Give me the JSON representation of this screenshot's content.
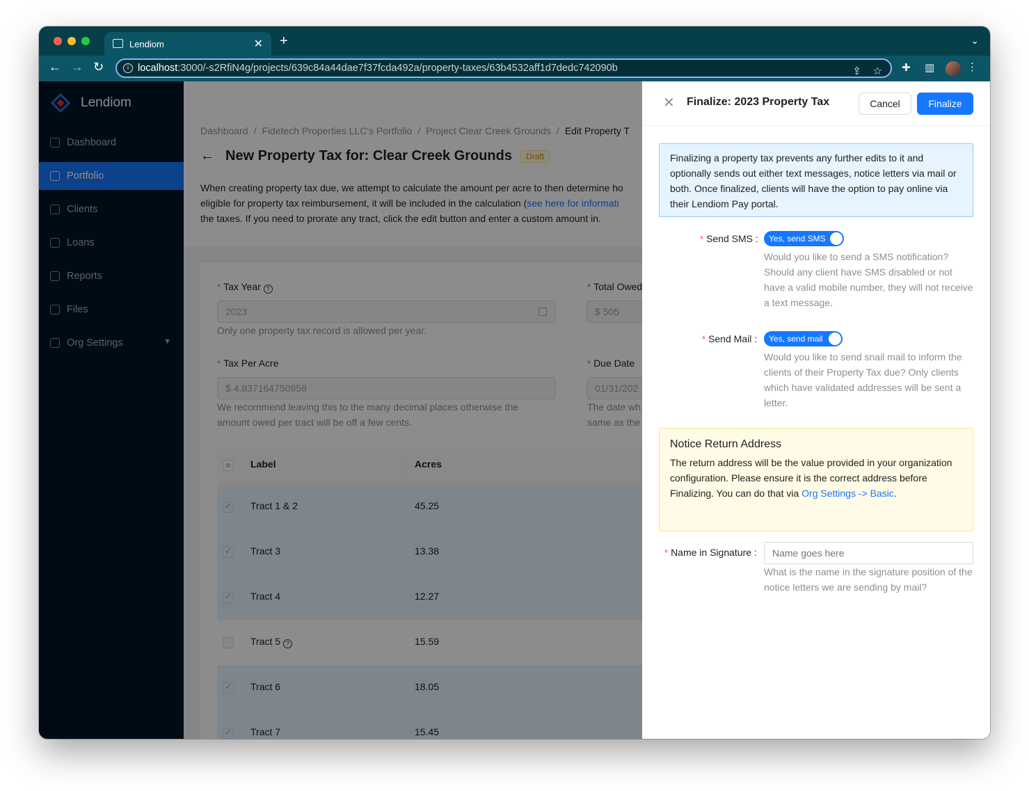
{
  "browser": {
    "tab_title": "Lendiom",
    "new_tab": "+",
    "url_host": "localhost",
    "url_path": ":3000/-s2RfiN4g/projects/639c84a44dae7f37fcda492a/property-taxes/63b4532aff1d7dedc742090b",
    "traffic_colors": [
      "#ff5f57",
      "#febc2e",
      "#28c840"
    ]
  },
  "sidebar": {
    "brand": "Lendiom",
    "items": [
      {
        "label": "Dashboard",
        "icon": "dashboard-icon"
      },
      {
        "label": "Portfolio",
        "icon": "portfolio-icon",
        "active": true
      },
      {
        "label": "Clients",
        "icon": "clients-icon"
      },
      {
        "label": "Loans",
        "icon": "loans-icon"
      },
      {
        "label": "Reports",
        "icon": "reports-icon"
      },
      {
        "label": "Files",
        "icon": "files-icon"
      },
      {
        "label": "Org Settings",
        "icon": "settings-icon"
      }
    ]
  },
  "page": {
    "breadcrumb": [
      "Dashboard",
      "Fidetech Properties LLC's Portfolio",
      "Project Clear Creek Grounds",
      "Edit Property T"
    ],
    "title": "New Property Tax for: Clear Creek Grounds",
    "tag": "Draft",
    "desc_1": "When creating property tax due, we attempt to calculate the amount per acre to then determine ho",
    "desc_2a": "eligible for property tax reimbursement, it will be included in the calculation (",
    "desc_link": "see here for informati",
    "desc_3": "the taxes. If you need to prorate any tract, click the edit button and enter a custom amount in."
  },
  "form": {
    "tax_year_label": "Tax Year",
    "tax_year_value": "2023",
    "tax_year_help": "Only one property tax record is allowed per year.",
    "total_owed_label": "Total Owed",
    "total_owed_value": "$ 505",
    "tax_per_acre_label": "Tax Per Acre",
    "tax_per_acre_value": "$ 4.837164750958",
    "tax_per_acre_help_1": "We recommend leaving this to the many decimal places otherwise the",
    "tax_per_acre_help_2": "amount owed per tract will be off a few cents.",
    "due_date_label": "Due Date",
    "due_date_value": "01/31/202",
    "due_date_help_1": "The date wh",
    "due_date_help_2": "same as the"
  },
  "table": {
    "headers": [
      "Label",
      "Acres"
    ],
    "rows": [
      {
        "label": "Tract 1 & 2",
        "acres": "45.25",
        "selected": true
      },
      {
        "label": "Tract 3",
        "acres": "13.38",
        "selected": true
      },
      {
        "label": "Tract 4",
        "acres": "12.27",
        "selected": true
      },
      {
        "label": "Tract 5",
        "acres": "15.59",
        "selected": false
      },
      {
        "label": "Tract 6",
        "acres": "18.05",
        "selected": true
      },
      {
        "label": "Tract 7",
        "acres": "15.45",
        "selected": true
      }
    ]
  },
  "drawer": {
    "title": "Finalize: 2023 Property Tax",
    "cancel": "Cancel",
    "finalize": "Finalize",
    "info": "Finalizing a property tax prevents any further edits to it and optionally sends out either text messages, notice letters via mail or both. Once finalized, clients will have the option to pay online via their Lendiom Pay portal.",
    "sms_label": "Send SMS",
    "sms_switch": "Yes, send SMS",
    "sms_help": "Would you like to send a SMS notification? Should any client have SMS disabled or not have a valid mobile number, they will not receive a text message.",
    "mail_label": "Send Mail",
    "mail_switch": "Yes, send mail",
    "mail_help": "Would you like to send snail mail to inform the clients of their Property Tax due? Only clients which have validated addresses will be sent a letter.",
    "notice_title": "Notice Return Address",
    "notice_body": "The return address will be the value provided in your organization configuration. Please ensure it is the correct address before Finalizing. You can do that via ",
    "notice_link": "Org Settings -> Basic",
    "notice_end": ".",
    "name_label": "Name in Signature",
    "name_placeholder": "Name goes here",
    "name_help": "What is the name in the signature position of the notice letters we are sending by mail?"
  }
}
